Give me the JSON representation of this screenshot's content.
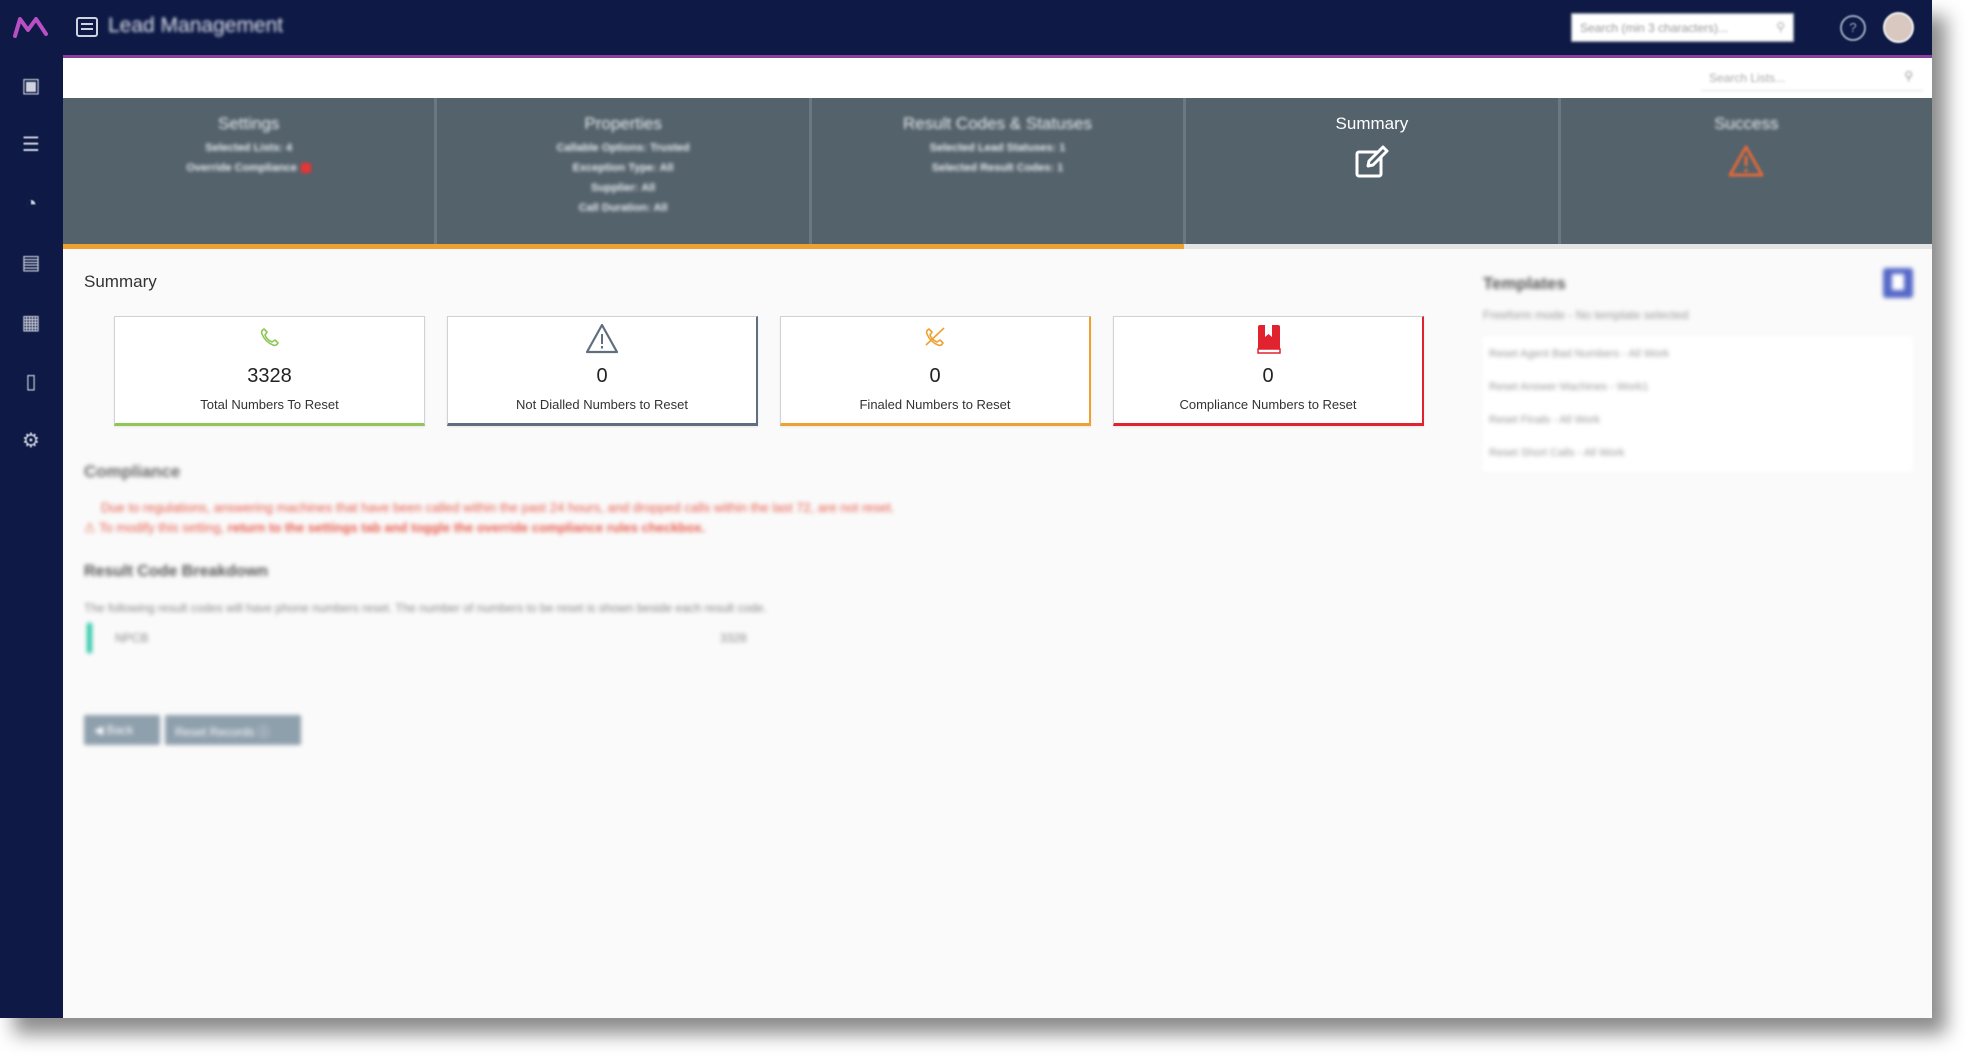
{
  "app": {
    "title": "Lead Management",
    "search_placeholder": "Search (min 3 characters)..."
  },
  "sub_header": {
    "list_search_placeholder": "Search Lists..."
  },
  "steps": [
    {
      "title": "Settings",
      "lines": [
        "Selected Lists: 4",
        "Override Compliance"
      ]
    },
    {
      "title": "Properties",
      "lines": [
        "Callable Options: Trusted",
        "Exception Type: All",
        "Supplier: All",
        "Call Duration: All"
      ]
    },
    {
      "title": "Result Codes & Statuses",
      "lines": [
        "Selected Lead Statuses: 1",
        "Selected Result Codes: 1"
      ]
    },
    {
      "title": "Summary",
      "lines": []
    },
    {
      "title": "Success",
      "lines": []
    }
  ],
  "progress": {
    "fraction": 0.6
  },
  "summary": {
    "title": "Summary",
    "cards": [
      {
        "value": "3328",
        "label": "Total Numbers To Reset",
        "icon": "phone-icon"
      },
      {
        "value": "0",
        "label": "Not Dialled Numbers to Reset",
        "icon": "warning-icon"
      },
      {
        "value": "0",
        "label": "Finaled Numbers to Reset",
        "icon": "phone-off-icon"
      },
      {
        "value": "0",
        "label": "Compliance Numbers to Reset",
        "icon": "book-bookmark-icon"
      }
    ]
  },
  "compliance": {
    "title": "Compliance",
    "line1": "Due to regulations, answering machines that have been called within the past 24 hours, and dropped calls within the last 72, are not reset.",
    "line2_prefix": "To modify this setting,",
    "line2_link": "return to the settings tab and toggle the override compliance rules checkbox."
  },
  "breakdown": {
    "title": "Result Code Breakdown",
    "description": "The following result codes will have phone numbers reset. The number of numbers to be reset is shown beside each result code.",
    "rows": [
      {
        "code": "NPCB",
        "count": "3328"
      }
    ]
  },
  "buttons": {
    "back": "Back",
    "reset": "Reset Records"
  },
  "templates": {
    "title": "Templates",
    "subtitle": "Freeform mode - No template selected",
    "items": [
      "Reset Agent Bad Numbers - All Work",
      "Reset Answer Machines - Work1",
      "Reset Finals - All Work",
      "Reset Short Calls - All Work"
    ]
  },
  "colors": {
    "nav": "#0e1a45",
    "steps_bg": "#54626c",
    "progress": "#f0a030",
    "card_green": "#8fc655",
    "card_slate": "#5f6f80",
    "card_amber": "#f0a030",
    "card_red": "#e0232f"
  }
}
